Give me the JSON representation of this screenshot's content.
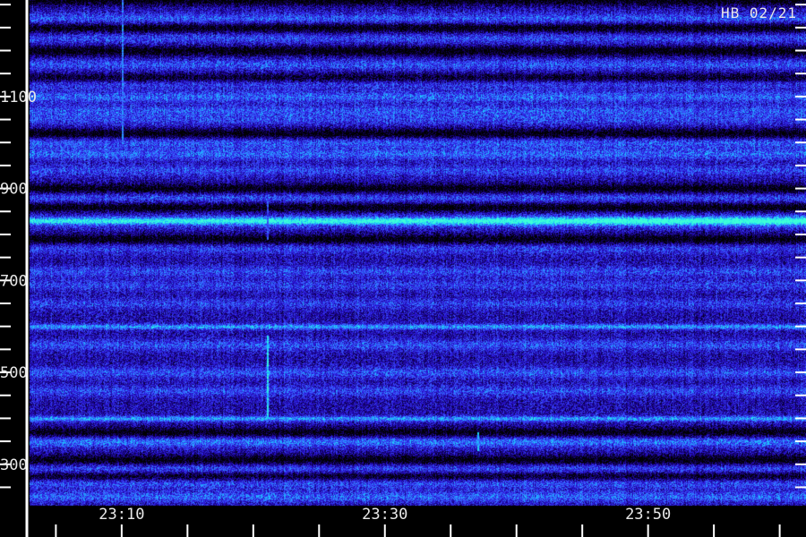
{
  "chart_data": {
    "type": "heatmap",
    "title": "",
    "stamp": "HB 02/21",
    "xlabel": "",
    "ylabel": "",
    "x_minutes_range": [
      "23:03",
      "24:02"
    ],
    "x_tick_labels": [
      "23:10",
      "23:30",
      "23:50"
    ],
    "y_tick_labels": [
      "1100",
      "900",
      "700",
      "500",
      "300"
    ],
    "ylim": [
      210,
      1310
    ],
    "y_minor_step": 50,
    "y_major_step": 100,
    "colormap": [
      "#000000",
      "#14006e",
      "#2a14d8",
      "#3c5cff",
      "#18c8ff",
      "#3cffd8"
    ],
    "bands": [
      {
        "freq": 1270,
        "level": 0.55
      },
      {
        "freq": 1228,
        "level": 0.45
      },
      {
        "freq": 1170,
        "level": 0.5
      },
      {
        "freq": 1130,
        "level": 0.55
      },
      {
        "freq": 1100,
        "level": 0.6
      },
      {
        "freq": 1070,
        "level": 0.5
      },
      {
        "freq": 1050,
        "level": 0.4
      },
      {
        "freq": 1000,
        "level": 0.55
      },
      {
        "freq": 975,
        "level": 0.6
      },
      {
        "freq": 940,
        "level": 0.45
      },
      {
        "freq": 880,
        "level": 0.5
      },
      {
        "freq": 830,
        "level": 0.85
      },
      {
        "freq": 770,
        "level": 0.4
      },
      {
        "freq": 720,
        "level": 0.45
      },
      {
        "freq": 690,
        "level": 0.4
      },
      {
        "freq": 650,
        "level": 0.4
      },
      {
        "freq": 600,
        "level": 0.9
      },
      {
        "freq": 560,
        "level": 0.5
      },
      {
        "freq": 500,
        "level": 0.5
      },
      {
        "freq": 460,
        "level": 0.45
      },
      {
        "freq": 400,
        "level": 0.9
      },
      {
        "freq": 350,
        "level": 0.7
      },
      {
        "freq": 290,
        "level": 0.55
      },
      {
        "freq": 260,
        "level": 0.55
      },
      {
        "freq": 230,
        "level": 0.6
      }
    ],
    "dark_gaps": [
      1310,
      1250,
      1200,
      1140,
      1020,
      900,
      860,
      790,
      370,
      310,
      275
    ],
    "vertical_streaks": [
      {
        "time": "23:10",
        "freq_range": [
          1000,
          1310
        ],
        "level": 0.7
      },
      {
        "time": "23:21",
        "freq_range": [
          400,
          580
        ],
        "level": 0.95
      },
      {
        "time": "23:21",
        "freq_range": [
          790,
          880
        ],
        "level": 0.6
      },
      {
        "time": "23:37",
        "freq_range": [
          330,
          370
        ],
        "level": 0.8
      }
    ]
  }
}
